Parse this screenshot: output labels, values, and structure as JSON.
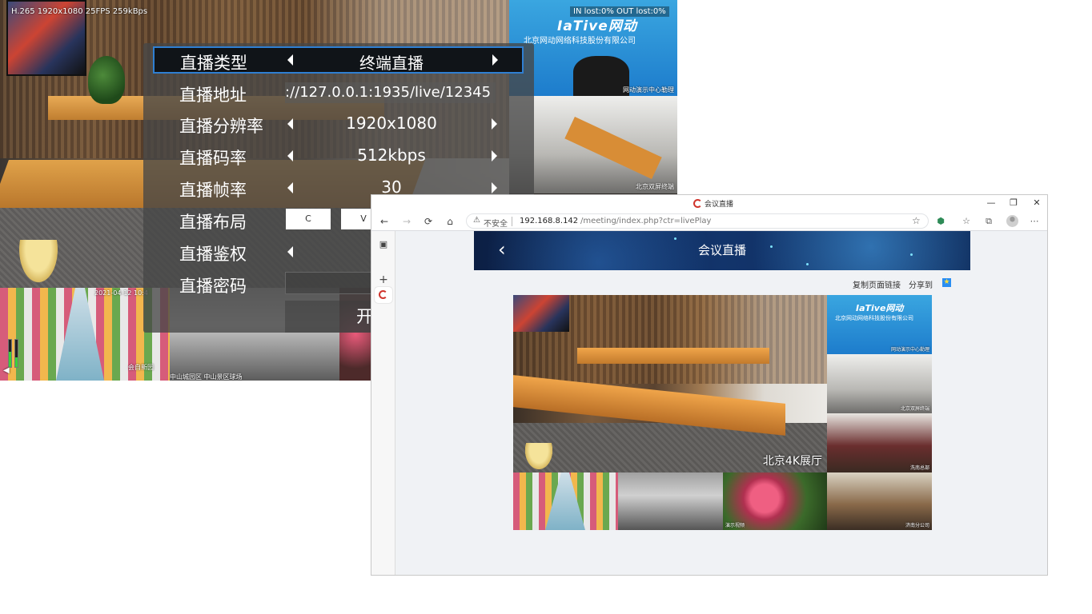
{
  "terminal": {
    "stream_info": "H.265 1920x1080 25FPS 259kBps",
    "loss_info": "IN lost:0% OUT lost:0%",
    "logo_text": "IaTive网动",
    "company_name": "北京网动网络科技股份有限公司",
    "tile_labels": {
      "right_top": "网动演示中心勒理",
      "right_middle": "北京双屏终端",
      "bottom_left_timestamp": "2021-04-12 10:4",
      "bottom_left_caption": "中山城园区 中山景区球场",
      "bottom_left_sub": "会自新园"
    }
  },
  "osd_menu": {
    "rows": [
      {
        "label": "直播类型",
        "value": "终端直播",
        "kind": "select",
        "selected": true
      },
      {
        "label": "直播地址",
        "value": "://127.0.0.1:1935/live/12345",
        "kind": "text"
      },
      {
        "label": "直播分辨率",
        "value": "1920x1080",
        "kind": "select"
      },
      {
        "label": "直播码率",
        "value": "512kbps",
        "kind": "select"
      },
      {
        "label": "直播帧率",
        "value": "30",
        "kind": "select"
      },
      {
        "label": "直播布局",
        "layout_options": [
          "C",
          "V"
        ],
        "kind": "layout"
      },
      {
        "label": "直播鉴权",
        "value": "",
        "kind": "select"
      },
      {
        "label": "直播密码",
        "value": "",
        "kind": "password"
      }
    ],
    "start_button_label": "开"
  },
  "browser": {
    "tab_title": "会议直播",
    "window_controls": {
      "minimize": "—",
      "restore": "❐",
      "close": "✕"
    },
    "nav": {
      "back": "←",
      "forward": "→",
      "reload": "⟳",
      "home": "⌂"
    },
    "address": {
      "security_label": "不安全",
      "host": "192.168.8.142",
      "path": "/meeting/index.php?ctr=livePlay"
    },
    "toolbar_icons": [
      "star-add-icon",
      "extension-icon",
      "favorites-icon",
      "collections-icon",
      "profile-icon",
      "more-icon"
    ],
    "side_panel_icons": [
      "tab-actions-icon",
      "tab-favicon",
      "new-tab-icon"
    ]
  },
  "page": {
    "header_title": "会议直播",
    "back_glyph": "‹",
    "copy_link_label": "复制页面链接",
    "share_label": "分享到",
    "video": {
      "main_label": "北京4K展厅",
      "tile_labels": [
        "网动演示中心勒理",
        "北京双屏终端",
        "洗南总部",
        "演示视频",
        "济南分公司"
      ]
    }
  }
}
